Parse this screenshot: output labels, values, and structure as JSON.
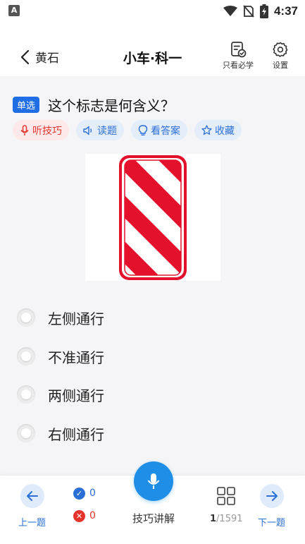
{
  "status_bar": {
    "left_icon": "A",
    "time": "4:37",
    "icons": [
      "wifi-icon",
      "no-sim-icon",
      "battery-charging-icon"
    ]
  },
  "header": {
    "back_label": "黄石",
    "title": "小车·科一",
    "only_must_label": "只看必学",
    "settings_label": "设置"
  },
  "question": {
    "type_badge": "单选",
    "text": "这个标志是何含义？",
    "actions": [
      {
        "label": "听技巧",
        "icon": "microphone-icon",
        "color": "#e5342c"
      },
      {
        "label": "读题",
        "icon": "speaker-icon",
        "color": "#2a6fd6"
      },
      {
        "label": "看答案",
        "icon": "lightbulb-icon",
        "color": "#2a6fd6"
      },
      {
        "label": "收藏",
        "icon": "star-icon",
        "color": "#2a6fd6"
      }
    ],
    "image": {
      "kind": "road-sign",
      "description_icon": "red-white-diagonal-stripe-marker",
      "stripe_color": "#e3112b",
      "base_color": "#ffffff"
    },
    "options": [
      {
        "text": "左侧通行"
      },
      {
        "text": "不准通行"
      },
      {
        "text": "两侧通行"
      },
      {
        "text": "右侧通行"
      }
    ]
  },
  "bottom_bar": {
    "prev_label": "上一题",
    "correct_count": "0",
    "wrong_count": "0",
    "tip_label": "技巧讲解",
    "page_current": "1",
    "page_total": "/1591",
    "next_label": "下一题",
    "colors": {
      "accent": "#1f8ee6",
      "blue": "#2a6fd6",
      "red": "#e5342c"
    }
  }
}
